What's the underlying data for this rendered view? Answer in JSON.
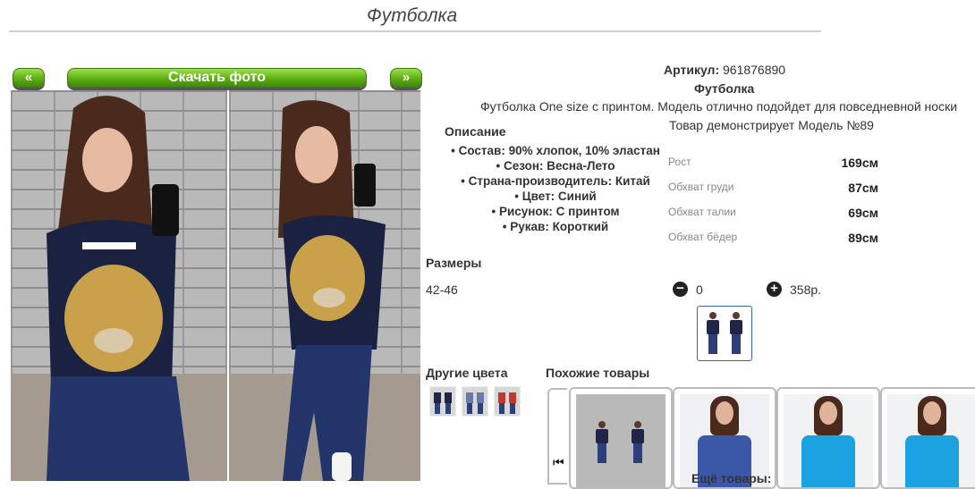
{
  "page": {
    "title": "Футболка"
  },
  "gallery": {
    "prev_label": "«",
    "next_label": "»",
    "download_label": "Скачать фото"
  },
  "product": {
    "article_label": "Артикул:",
    "article_value": "961876890",
    "name": "Футболка",
    "description": "Футболка One size с принтом. Модель отлично подойдет для повседневной носки",
    "model_note": "Товар демонстрирует Модель №89"
  },
  "description": {
    "heading": "Описание",
    "items": [
      "Состав: 90% хлопок, 10% эластан",
      "Сезон: Весна-Лето",
      "Страна-производитель: Китай",
      "Цвет: Синий",
      "Рисунок: С принтом",
      "Рукав: Короткий"
    ]
  },
  "measurements": [
    {
      "label": "Рост",
      "value": "169см"
    },
    {
      "label": "Обхват груди",
      "value": "87см"
    },
    {
      "label": "Обхват талии",
      "value": "69см"
    },
    {
      "label": "Обхват бёдер",
      "value": "89см"
    }
  ],
  "sizes": {
    "heading": "Размеры",
    "size": "42-46",
    "minus": "−",
    "quantity": "0",
    "plus": "+",
    "price": "358р."
  },
  "other_colors": {
    "heading": "Другие цвета"
  },
  "similar": {
    "heading": "Похожие товары",
    "scroll_left": "⏮",
    "more_label": "Ещё товары:"
  },
  "colors": {
    "accent_green": "#5cae14",
    "thumb_border": "#3a64a8",
    "navy_tee": "#1e2546",
    "blue_tee": "#3b57a8",
    "cyan_tee": "#1aa3e0"
  }
}
